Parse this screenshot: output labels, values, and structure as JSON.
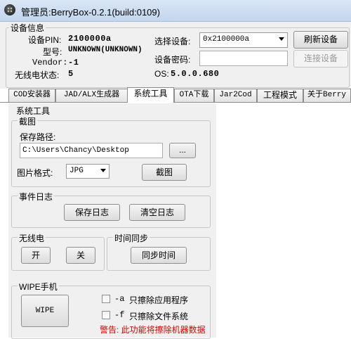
{
  "window": {
    "title": "管理员:BerryBox-0.2.1(build:0109)"
  },
  "device_info": {
    "group_title": "设备信息",
    "pin_label": "设备PIN:",
    "pin_value": "2100000a",
    "model_label": "型号:",
    "model_value": "UNKNOWN(UNKNOWN)",
    "vendor_label": "Vendor:",
    "vendor_value": "-1",
    "radio_label": "无线电状态:",
    "radio_value": "5",
    "select_device_label": "选择设备:",
    "select_device_value": "0x2100000a",
    "refresh_button": "刷新设备",
    "password_label": "设备密码:",
    "password_value": "",
    "connect_button": "连接设备",
    "os_label": "OS:",
    "os_value": "5.0.0.680"
  },
  "tabs": [
    {
      "label": "COD安装器"
    },
    {
      "label": "JAD/ALX生成器"
    },
    {
      "label": "系统工具",
      "active": true
    },
    {
      "label": "OTA下载"
    },
    {
      "label": "Jar2Cod"
    },
    {
      "label": "工程模式"
    },
    {
      "label": "关于Berry"
    }
  ],
  "system_tools": {
    "group_title": "系统工具",
    "screenshot": {
      "group_title": "截图",
      "path_label": "保存路径:",
      "path_value": "C:\\Users\\Chancy\\Desktop",
      "browse_button": "...",
      "format_label": "图片格式:",
      "format_value": "JPG",
      "capture_button": "截图"
    },
    "event_log": {
      "group_title": "事件日志",
      "save_button": "保存日志",
      "clear_button": "清空日志"
    },
    "radio": {
      "group_title": "无线电",
      "on_button": "开",
      "off_button": "关"
    },
    "time_sync": {
      "group_title": "时间同步",
      "sync_button": "同步时间"
    },
    "wipe": {
      "group_title": "WIPE手机",
      "wipe_button": "WIPE",
      "option_a_flag": "-a",
      "option_a_label": "只擦除应用程序",
      "option_a_checked": false,
      "option_f_flag": "-f",
      "option_f_label": "只擦除文件系统",
      "option_f_checked": false,
      "warning": "警告: 此功能将擦除机器数据"
    }
  },
  "colors": {
    "warning": "#e00000",
    "titlebar": "#c3d6ee"
  }
}
